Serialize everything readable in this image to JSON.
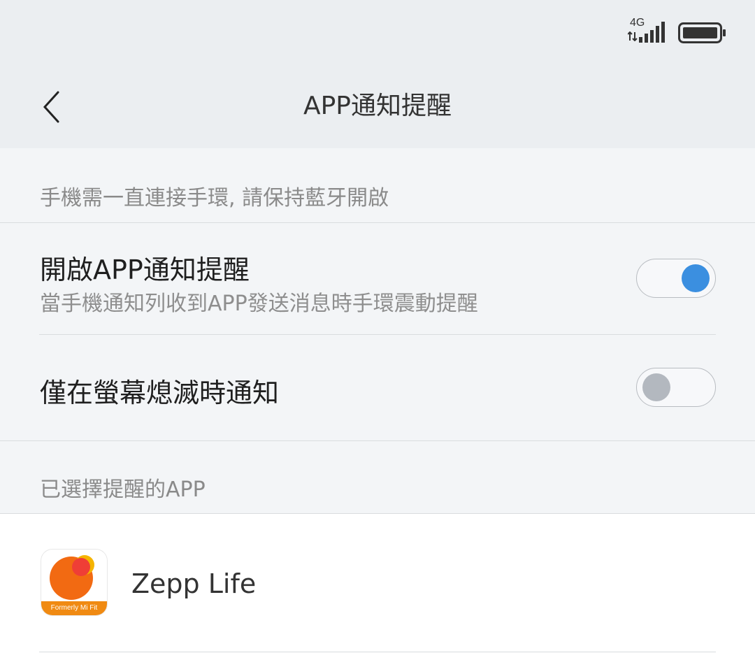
{
  "status_bar": {
    "network": "4G",
    "icons": [
      "data-arrows-icon",
      "signal-icon",
      "battery-icon"
    ]
  },
  "header": {
    "back_icon": "chevron-left-icon",
    "title": "APP通知提醒"
  },
  "notice": "手機需一直連接手環, 請保持藍牙開啟",
  "settings": [
    {
      "title": "開啟APP通知提醒",
      "subtitle": "當手機通知列收到APP發送消息時手環震動提醒",
      "enabled": true
    },
    {
      "title": "僅在螢幕熄滅時通知",
      "enabled": false
    }
  ],
  "apps_section": {
    "header": "已選擇提醒的APP",
    "apps": [
      {
        "name": "Zepp Life",
        "icon_caption": "Formerly Mi Fit",
        "icon": "zepp-life-app-icon"
      }
    ]
  },
  "colors": {
    "toggle_on": "#3b8fe0",
    "toggle_off": "#b3b8bf",
    "header_bg": "#ebeef1",
    "app_icon_orange": "#f26a12"
  }
}
